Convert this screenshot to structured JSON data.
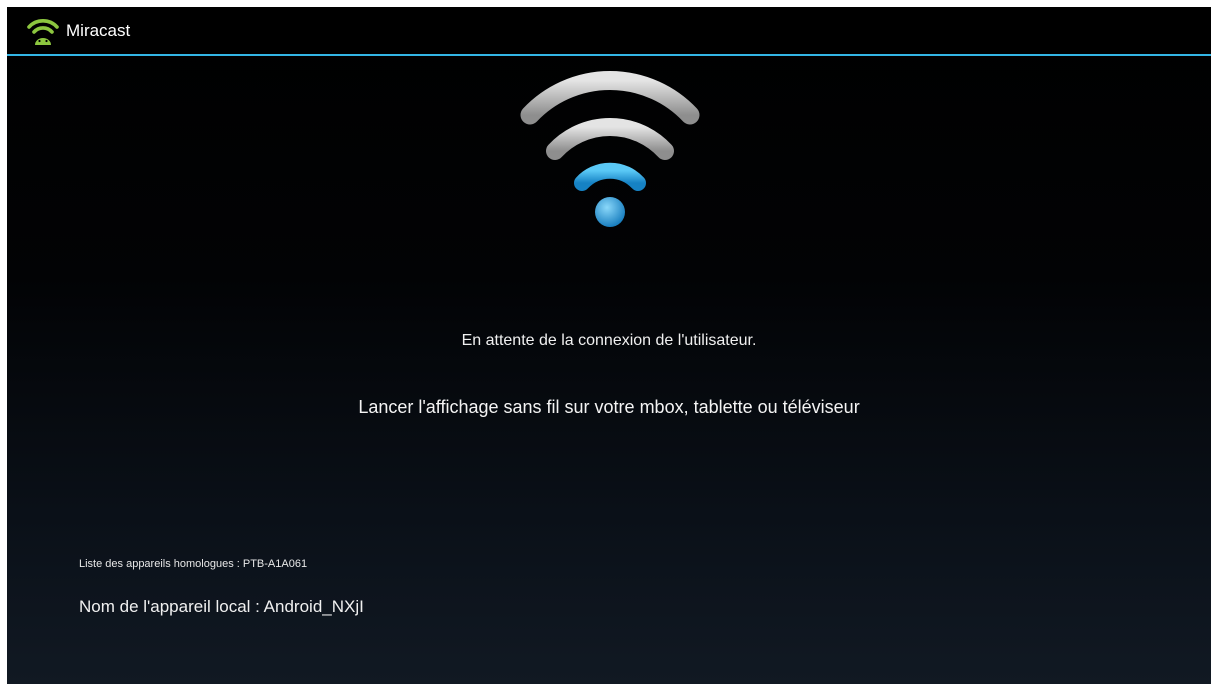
{
  "app": {
    "title": "Miracast",
    "icon": "wifi-icon",
    "accent_color": "#33b5e5",
    "icon_color": "#8cc63f"
  },
  "main": {
    "status": "En attente de la connexion de l'utilisateur.",
    "instruction": "Lancer l'affichage sans fil sur votre mbox, tablette ou téléviseur",
    "graphic_icon": "wifi-signal-icon"
  },
  "footer": {
    "peer_list": "Liste des appareils homologues : PTB-A1A061",
    "local_device": "Nom de l'appareil local : Android_NXjI"
  }
}
